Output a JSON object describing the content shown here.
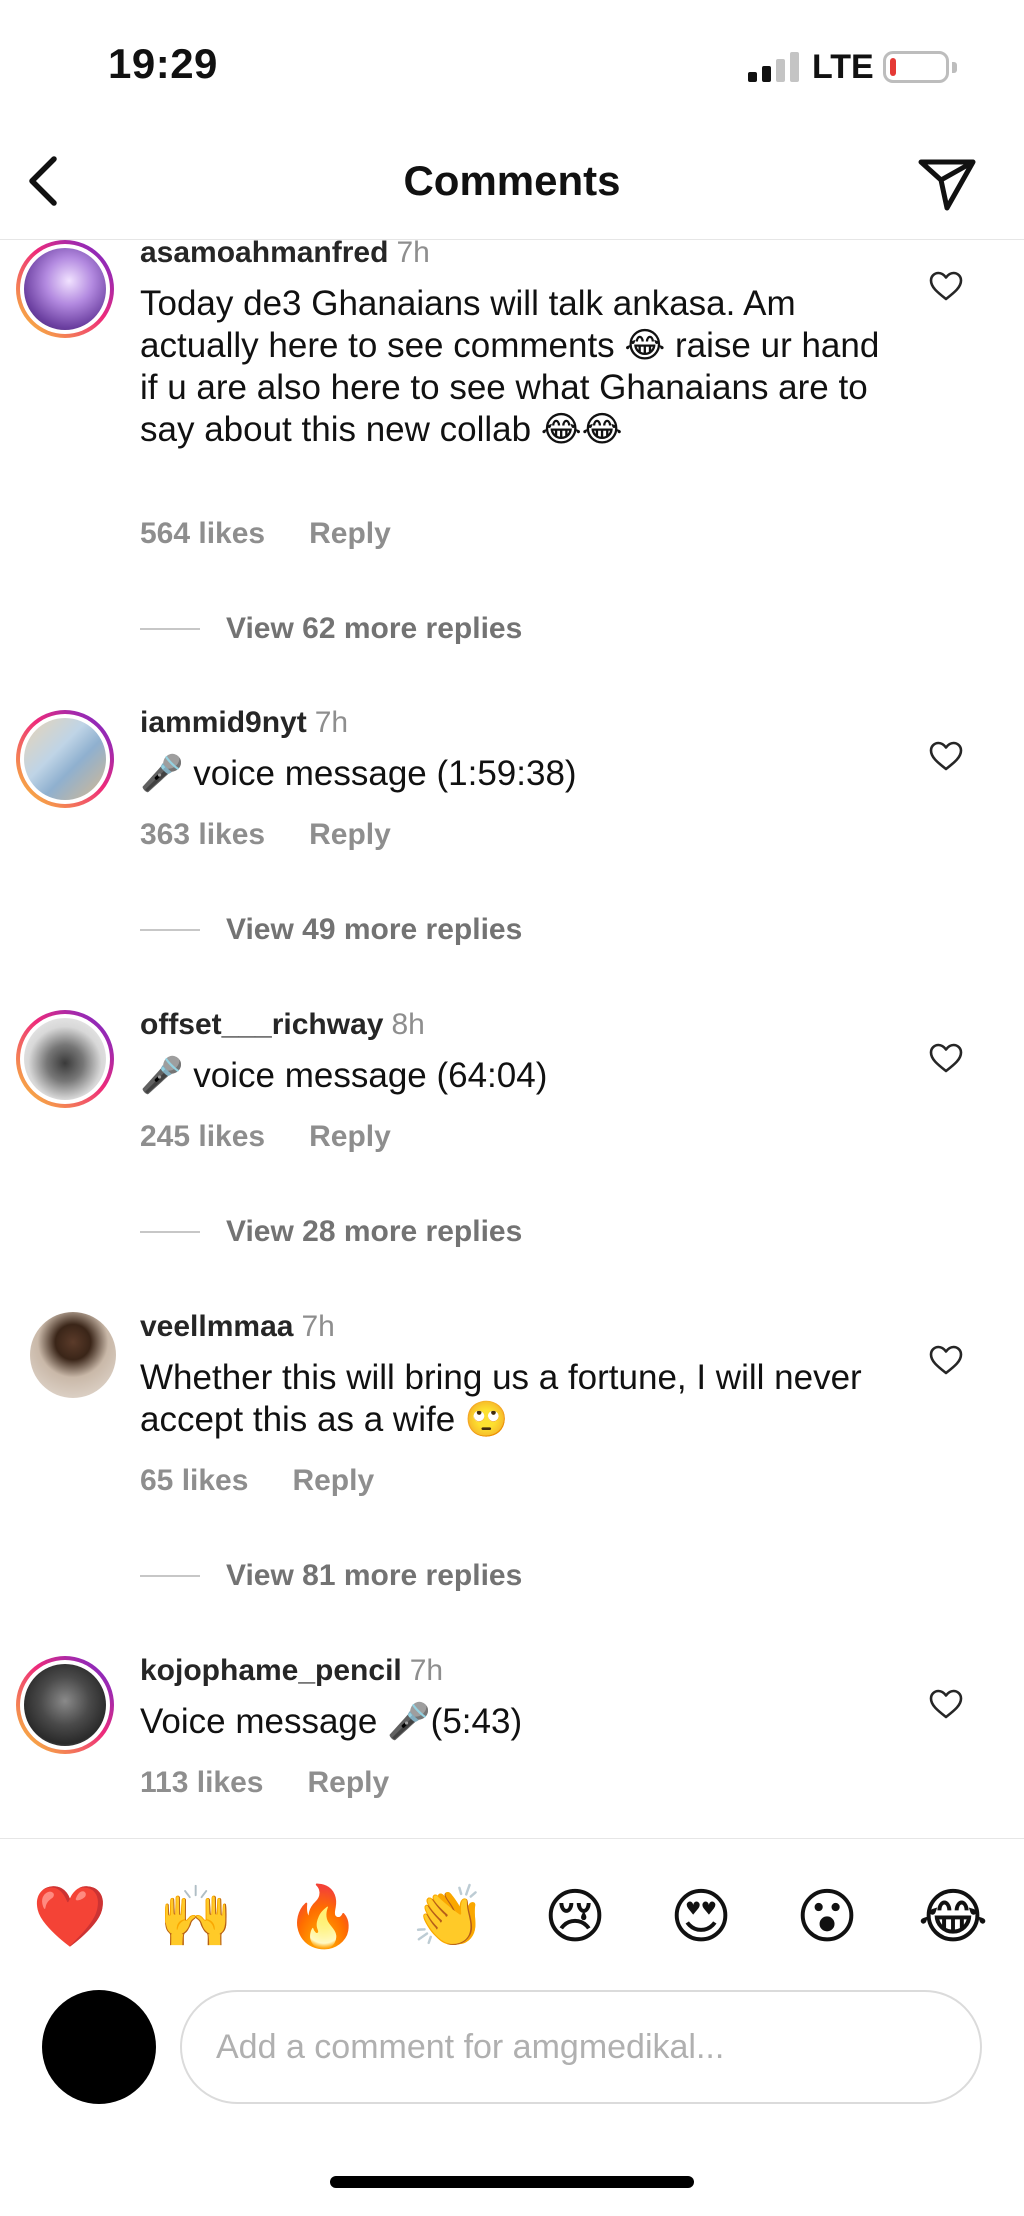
{
  "status_bar": {
    "time": "19:29",
    "network": "LTE",
    "battery_color": "#e53935"
  },
  "header": {
    "title": "Comments",
    "back_icon": "chevron-left-icon",
    "share_icon": "paper-plane-icon"
  },
  "comments": [
    {
      "username": "asamoahmanfred",
      "time": "7h",
      "text": "Today de3 Ghanaians will talk ankasa. Am actually here to see comments 😂 raise ur hand if u are also here to see what Ghanaians are to say about this new collab 😂😂",
      "likes": "564 likes",
      "reply": "Reply",
      "view_replies": "View 62 more replies",
      "avatar_color": "#8e6bbf"
    },
    {
      "username": "iammid9nyt",
      "time": "7h",
      "text": "🎤 voice message (1:59:38)",
      "likes": "363 likes",
      "reply": "Reply",
      "view_replies": "View 49 more replies",
      "avatar_color": "#a8bcd0"
    },
    {
      "username": "offset___richway",
      "time": "8h",
      "text": "🎤 voice message (64:04)",
      "likes": "245 likes",
      "reply": "Reply",
      "view_replies": "View 28 more replies",
      "avatar_color": "#cfcfcf"
    },
    {
      "username": "veellmmaa",
      "time": "7h",
      "text": "Whether this will bring us a fortune, I will never accept this as a wife 🙄",
      "likes": "65 likes",
      "reply": "Reply",
      "view_replies": "View 81 more replies",
      "avatar_color": "#7a5c48"
    },
    {
      "username": "kojophame_pencil",
      "time": "7h",
      "text": "Voice message 🎤(5:43)",
      "likes": "113 likes",
      "reply": "Reply",
      "view_replies": "",
      "avatar_color": "#555555"
    }
  ],
  "reactions": [
    "❤️",
    "🙌",
    "🔥",
    "👏",
    "😢",
    "😍",
    "😮",
    "😂"
  ],
  "composer": {
    "placeholder": "Add a comment for amgmedikal..."
  }
}
